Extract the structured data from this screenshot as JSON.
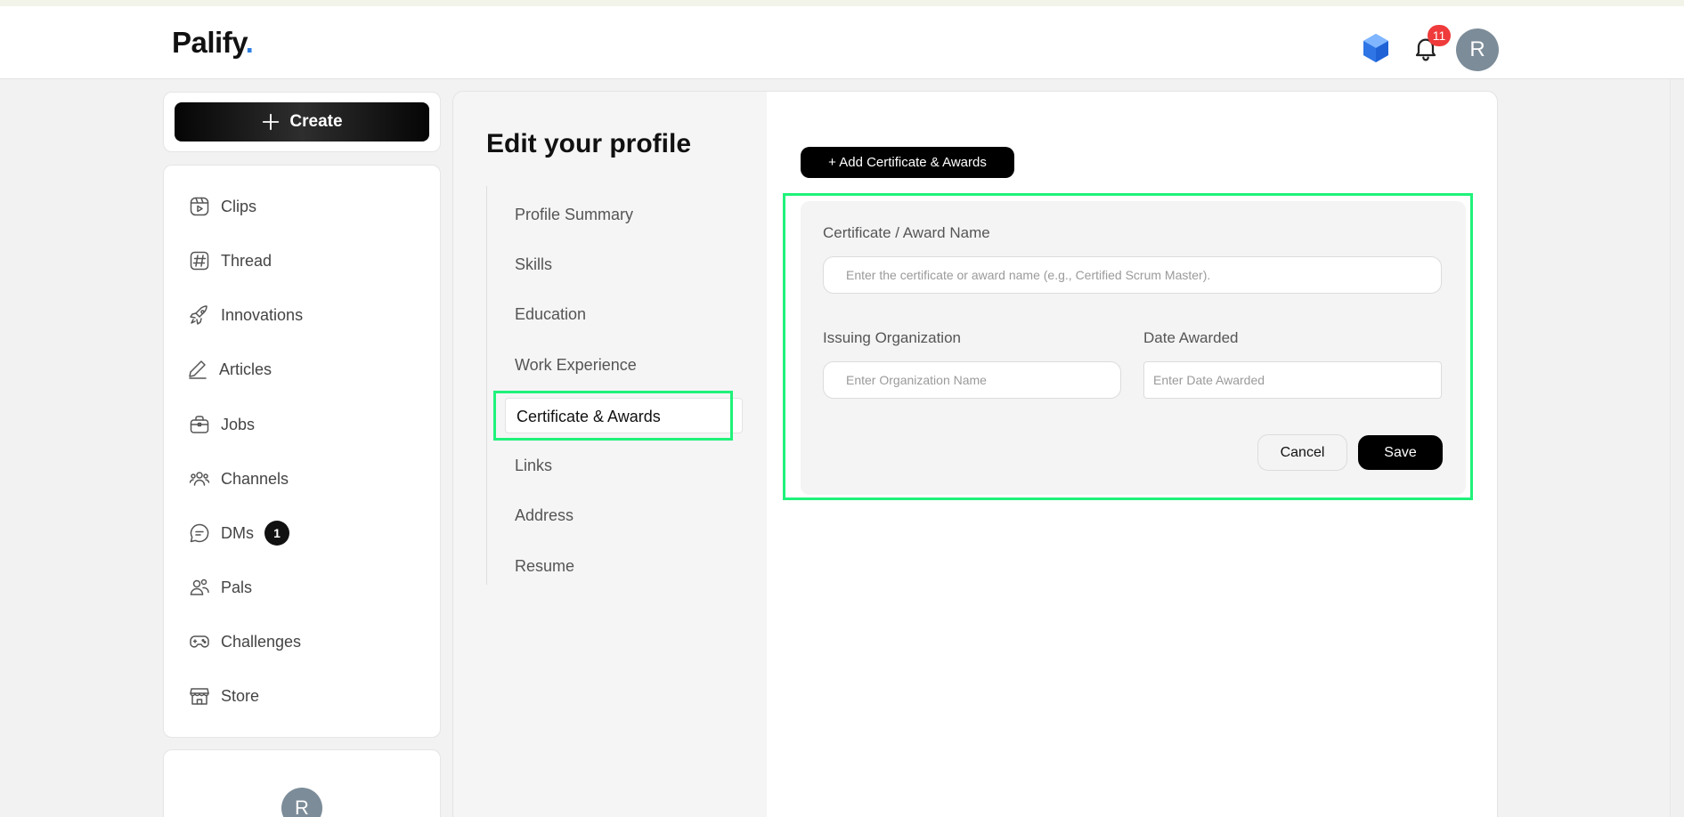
{
  "app": {
    "brand": "Palify",
    "brand_dot": "."
  },
  "header": {
    "notification_count": "11",
    "avatar_initial": "R"
  },
  "sidebar": {
    "create_label": "Create",
    "items": [
      {
        "label": "Clips",
        "icon": "clips-icon"
      },
      {
        "label": "Thread",
        "icon": "hashtag-icon"
      },
      {
        "label": "Innovations",
        "icon": "rocket-icon"
      },
      {
        "label": "Articles",
        "icon": "pencil-icon"
      },
      {
        "label": "Jobs",
        "icon": "briefcase-icon"
      },
      {
        "label": "Channels",
        "icon": "users-group-icon"
      },
      {
        "label": "DMs",
        "icon": "chat-bubble-icon",
        "badge": "1"
      },
      {
        "label": "Pals",
        "icon": "pals-icon"
      },
      {
        "label": "Challenges",
        "icon": "gamepad-icon"
      },
      {
        "label": "Store",
        "icon": "store-icon"
      }
    ],
    "profile_initial": "R"
  },
  "profile_menu": {
    "title": "Edit your profile",
    "items": [
      "Profile Summary",
      "Skills",
      "Education",
      "Work Experience",
      "Certificate & Awards",
      "Links",
      "Address",
      "Resume"
    ],
    "active_index": 4
  },
  "form": {
    "add_button": "+ Add Certificate & Awards",
    "name_label": "Certificate / Award Name",
    "name_placeholder": "Enter the certificate or award name (e.g., Certified Scrum Master).",
    "org_label": "Issuing Organization",
    "org_placeholder": "Enter Organization Name",
    "date_label": "Date Awarded",
    "date_placeholder": "Enter Date Awarded",
    "cancel_label": "Cancel",
    "save_label": "Save"
  },
  "colors": {
    "accent_dot": "#2f7fe0",
    "highlight": "#1ff27a",
    "badge_red": "#ef3b3b",
    "primary_button": "#000000"
  }
}
